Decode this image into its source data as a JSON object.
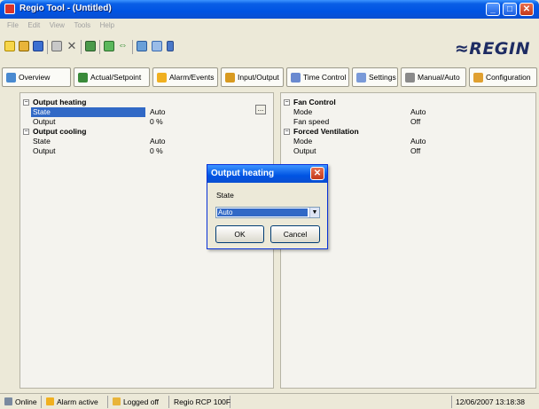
{
  "window": {
    "title": "Regio Tool - (Untitled)",
    "controls": {
      "minimize": "_",
      "maximize": "□",
      "close": "✕"
    }
  },
  "menu": [
    "File",
    "Edit",
    "View",
    "Tools",
    "Help"
  ],
  "brand": {
    "logo_text": "≈REGIN",
    "color": "#1e2c63"
  },
  "toolbar_icons": [
    "new-icon",
    "open-icon",
    "save-icon",
    "print-icon",
    "delete-icon",
    "refresh-icon",
    "connect-icon",
    "transfer-icon",
    "check-icon",
    "edit-icon",
    "wand-icon"
  ],
  "tabs": [
    {
      "label": "Overview",
      "icon": "overview-icon"
    },
    {
      "label": "Actual/Setpoint",
      "icon": "setpoint-icon"
    },
    {
      "label": "Alarm/Events",
      "icon": "alarm-icon"
    },
    {
      "label": "Input/Output",
      "icon": "io-icon"
    },
    {
      "label": "Time Control",
      "icon": "clock-icon"
    },
    {
      "label": "Settings",
      "icon": "settings-icon"
    },
    {
      "label": "Manual/Auto",
      "icon": "manual-icon"
    },
    {
      "label": "Configuration",
      "icon": "config-icon"
    }
  ],
  "left_panel": {
    "groups": [
      {
        "name": "Output heating",
        "rows": [
          {
            "label": "State",
            "value": "Auto"
          },
          {
            "label": "Output",
            "value": "0 %"
          }
        ]
      },
      {
        "name": "Output cooling",
        "rows": [
          {
            "label": "State",
            "value": "Auto"
          },
          {
            "label": "Output",
            "value": "0 %"
          }
        ]
      }
    ],
    "ellipsis_button": "..."
  },
  "right_panel": {
    "groups": [
      {
        "name": "Fan Control",
        "rows": [
          {
            "label": "Mode",
            "value": "Auto"
          },
          {
            "label": "Fan speed",
            "value": "Off"
          }
        ]
      },
      {
        "name": "Forced Ventilation",
        "rows": [
          {
            "label": "Mode",
            "value": "Auto"
          },
          {
            "label": "Output",
            "value": "Off"
          }
        ]
      }
    ]
  },
  "dialog": {
    "title": "Output heating",
    "field_label": "State",
    "selected_value": "Auto",
    "ok_label": "OK",
    "cancel_label": "Cancel",
    "close": "✕"
  },
  "status": {
    "online": "Online",
    "alarm": "Alarm active",
    "login": "Logged off",
    "device": "Regio RCP 100F",
    "datetime": "12/06/2007 13:18:38"
  },
  "colors": {
    "titlebar": "#0054e3",
    "selection": "#3169c6"
  }
}
